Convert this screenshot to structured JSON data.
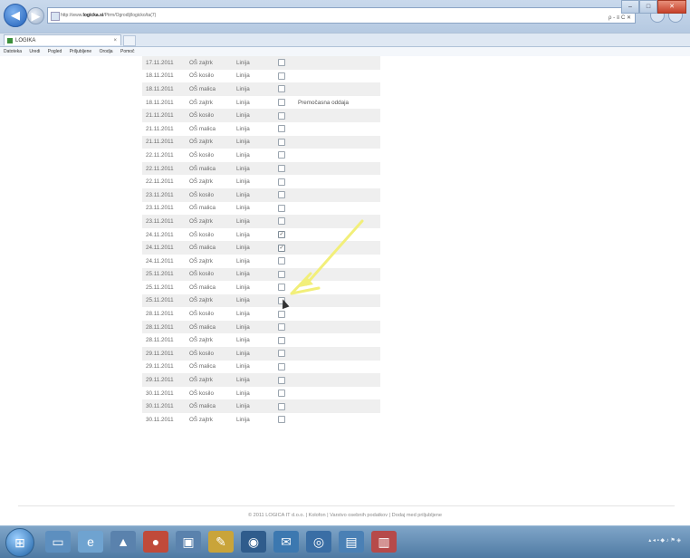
{
  "browser": {
    "url_prefix": "http://www.",
    "url_host": "logicka.si",
    "url_rest": "/Ptrm/Ogrodlj/logicko/ta(7)",
    "tab_title": "LOGIKA",
    "tab_close": "×",
    "menu": [
      "Datoteka",
      "Uredi",
      "Pogled",
      "Priljubljene",
      "Orodja",
      "Pomoč"
    ],
    "addr_tools": "ρ - ≡ C ✕"
  },
  "table": {
    "rows": [
      {
        "date": "17.11.2011",
        "shift": "OŠ zajtrk",
        "line": "Linija",
        "checked": false,
        "note": ""
      },
      {
        "date": "18.11.2011",
        "shift": "OŠ kosilo",
        "line": "Linija",
        "checked": false,
        "note": ""
      },
      {
        "date": "18.11.2011",
        "shift": "OŠ malica",
        "line": "Linija",
        "checked": false,
        "note": ""
      },
      {
        "date": "18.11.2011",
        "shift": "OŠ zajtrk",
        "line": "Linija",
        "checked": false,
        "note": "Premočasna oddaja"
      },
      {
        "date": "21.11.2011",
        "shift": "OŠ kosilo",
        "line": "Linija",
        "checked": false,
        "note": ""
      },
      {
        "date": "21.11.2011",
        "shift": "OŠ malica",
        "line": "Linija",
        "checked": false,
        "note": ""
      },
      {
        "date": "21.11.2011",
        "shift": "OŠ zajtrk",
        "line": "Linija",
        "checked": false,
        "note": ""
      },
      {
        "date": "22.11.2011",
        "shift": "OŠ kosilo",
        "line": "Linija",
        "checked": false,
        "note": ""
      },
      {
        "date": "22.11.2011",
        "shift": "OŠ malica",
        "line": "Linija",
        "checked": false,
        "note": ""
      },
      {
        "date": "22.11.2011",
        "shift": "OŠ zajtrk",
        "line": "Linija",
        "checked": false,
        "note": ""
      },
      {
        "date": "23.11.2011",
        "shift": "OŠ kosilo",
        "line": "Linija",
        "checked": false,
        "note": ""
      },
      {
        "date": "23.11.2011",
        "shift": "OŠ malica",
        "line": "Linija",
        "checked": false,
        "note": ""
      },
      {
        "date": "23.11.2011",
        "shift": "OŠ zajtrk",
        "line": "Linija",
        "checked": false,
        "note": ""
      },
      {
        "date": "24.11.2011",
        "shift": "OŠ kosilo",
        "line": "Linija",
        "checked": true,
        "note": ""
      },
      {
        "date": "24.11.2011",
        "shift": "OŠ malica",
        "line": "Linija",
        "checked": true,
        "note": ""
      },
      {
        "date": "24.11.2011",
        "shift": "OŠ zajtrk",
        "line": "Linija",
        "checked": false,
        "note": ""
      },
      {
        "date": "25.11.2011",
        "shift": "OŠ kosilo",
        "line": "Linija",
        "checked": false,
        "note": ""
      },
      {
        "date": "25.11.2011",
        "shift": "OŠ malica",
        "line": "Linija",
        "checked": false,
        "note": ""
      },
      {
        "date": "25.11.2011",
        "shift": "OŠ zajtrk",
        "line": "Linija",
        "checked": false,
        "note": ""
      },
      {
        "date": "28.11.2011",
        "shift": "OŠ kosilo",
        "line": "Linija",
        "checked": false,
        "note": ""
      },
      {
        "date": "28.11.2011",
        "shift": "OŠ malica",
        "line": "Linija",
        "checked": false,
        "note": ""
      },
      {
        "date": "28.11.2011",
        "shift": "OŠ zajtrk",
        "line": "Linija",
        "checked": false,
        "note": ""
      },
      {
        "date": "29.11.2011",
        "shift": "OŠ kosilo",
        "line": "Linija",
        "checked": false,
        "note": ""
      },
      {
        "date": "29.11.2011",
        "shift": "OŠ malica",
        "line": "Linija",
        "checked": false,
        "note": ""
      },
      {
        "date": "29.11.2011",
        "shift": "OŠ zajtrk",
        "line": "Linija",
        "checked": false,
        "note": ""
      },
      {
        "date": "30.11.2011",
        "shift": "OŠ kosilo",
        "line": "Linija",
        "checked": false,
        "note": ""
      },
      {
        "date": "30.11.2011",
        "shift": "OŠ malica",
        "line": "Linija",
        "checked": false,
        "note": ""
      },
      {
        "date": "30.11.2011",
        "shift": "OŠ zajtrk",
        "line": "Linija",
        "checked": false,
        "note": ""
      }
    ]
  },
  "footer": {
    "copyright": "© 2011 LOGICA IT d.o.o.",
    "sep": " | ",
    "link_1": "Kolofon",
    "link_2": "Varstvo osebnih podatkov",
    "link_3": "Dodaj med priljubljene"
  },
  "colors": {
    "highlight_arrow": "#f2ef7a",
    "row_alt": "#efefef"
  }
}
